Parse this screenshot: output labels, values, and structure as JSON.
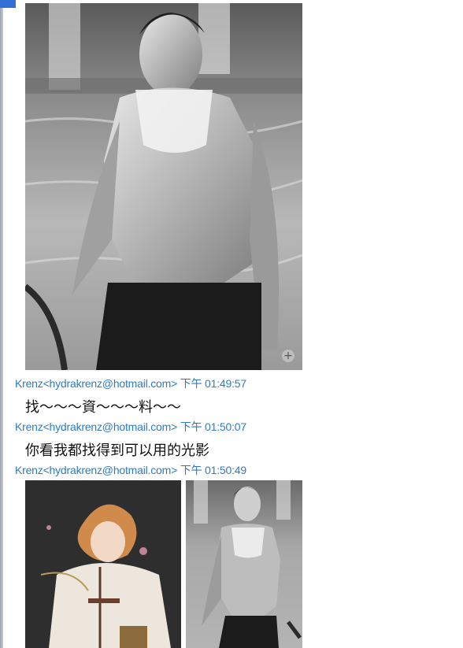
{
  "messages": [
    {
      "sender": "Krenz<hydrakrenz@hotmail.com>",
      "time": "下午 01:49:57",
      "text": "找～～～資～～～料～～"
    },
    {
      "sender": "Krenz<hydrakrenz@hotmail.com>",
      "time": "下午 01:50:07",
      "text": "你看我都找得到可以用的光影"
    },
    {
      "sender": "Krenz<hydrakrenz@hotmail.com>",
      "time": "下午 01:50:49"
    }
  ],
  "icons": {
    "zoom": "zoom-plus-icon"
  },
  "colors": {
    "sender_text": "#2f7bc1",
    "message_text": "#111111",
    "rail": "#9aa3b0",
    "accent": "#2f6fd6"
  }
}
